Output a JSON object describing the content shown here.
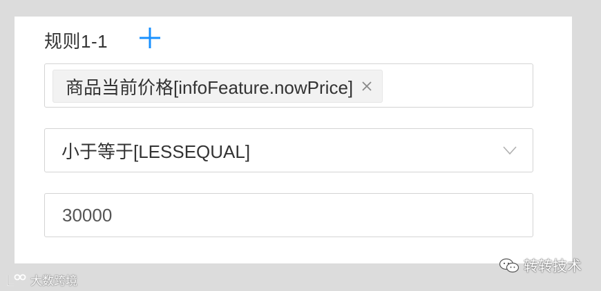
{
  "rule": {
    "title": "规则1-1",
    "add_icon": "plus-icon"
  },
  "field_select": {
    "tag_label": "商品当前价格[infoFeature.nowPrice]",
    "tag_remove_icon": "close-icon"
  },
  "operator_select": {
    "selected": "小于等于[LESSEQUAL]",
    "dropdown_icon": "chevron-down-icon"
  },
  "value_input": {
    "value": "30000"
  },
  "overlay": {
    "wechat_label": "转转技术",
    "watermark_label": "大数跨境"
  },
  "colors": {
    "accent": "#1890ff",
    "border": "#d3d3d3",
    "tag_bg": "#f2f2f2",
    "page_bg": "#dcdcdc"
  }
}
